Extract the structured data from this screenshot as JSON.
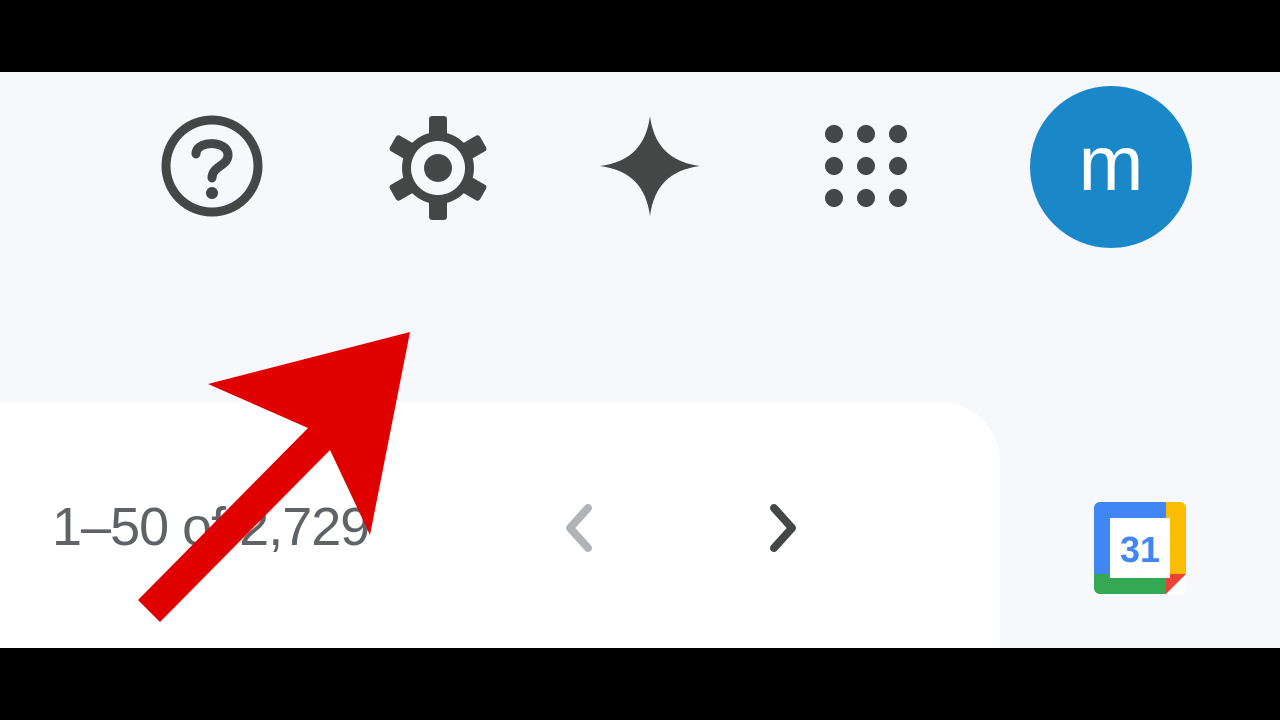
{
  "header": {
    "help_icon": "help-circle-icon",
    "settings_icon": "gear-icon",
    "gemini_icon": "sparkle-icon",
    "apps_icon": "apps-grid-icon",
    "avatar": {
      "initial": "m",
      "color": "#1a87c8"
    }
  },
  "pagination": {
    "range_text": "1–50 of 2,729",
    "prev_icon": "chevron-left-icon",
    "next_icon": "chevron-right-icon"
  },
  "side_panel": {
    "calendar_icon": "google-calendar-icon",
    "calendar_day": "31"
  },
  "annotation": {
    "arrow_icon": "red-pointer-arrow-icon",
    "arrow_color": "#e00000"
  },
  "colors": {
    "page_bg": "#f6f8fc",
    "panel_bg": "#ffffff",
    "icon_color": "#444746",
    "disabled_icon": "#b0b3b8"
  }
}
